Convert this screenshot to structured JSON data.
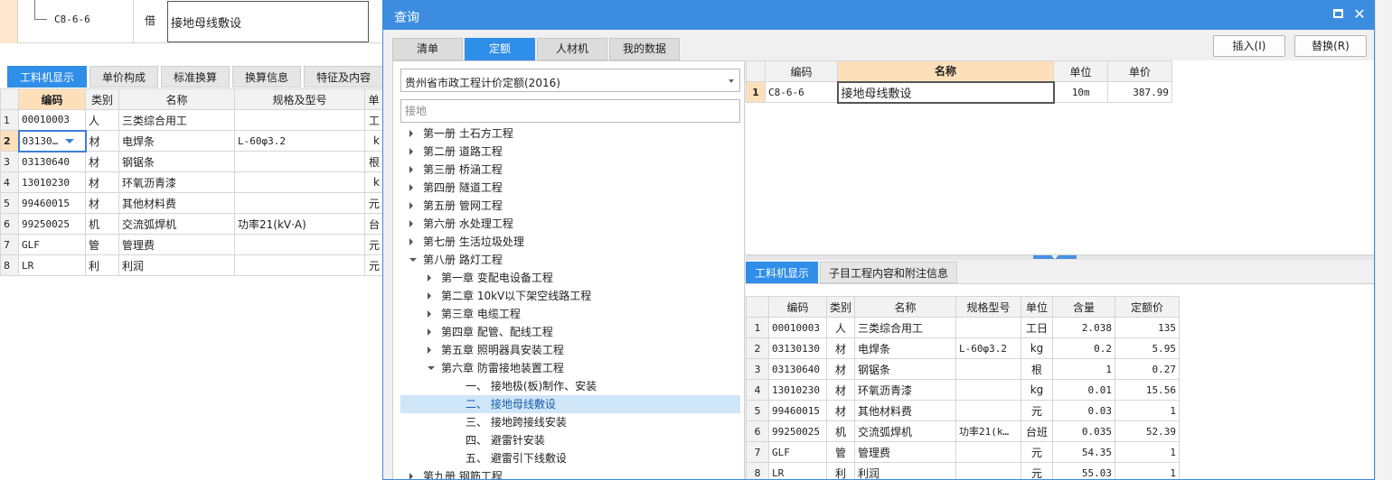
{
  "background": {
    "top_row": {
      "code": "C8-6-6",
      "type": "借",
      "name": "接地母线敷设"
    },
    "tabs": [
      "工料机显示",
      "单价构成",
      "标准换算",
      "换算信息",
      "特征及内容"
    ],
    "grid": {
      "headers": [
        "编码",
        "类别",
        "名称",
        "规格及型号",
        "单"
      ],
      "rows": [
        {
          "n": "1",
          "code": "00010003",
          "type": "人",
          "name": "三类综合用工",
          "spec": "",
          "unit": "工"
        },
        {
          "n": "2",
          "code": "03130…",
          "type": "材",
          "name": "电焊条",
          "spec": "L-60φ3.2",
          "unit": "k"
        },
        {
          "n": "3",
          "code": "03130640",
          "type": "材",
          "name": "钢锯条",
          "spec": "",
          "unit": "根"
        },
        {
          "n": "4",
          "code": "13010230",
          "type": "材",
          "name": "环氧沥青漆",
          "spec": "",
          "unit": "k"
        },
        {
          "n": "5",
          "code": "99460015",
          "type": "材",
          "name": "其他材料费",
          "spec": "",
          "unit": "元"
        },
        {
          "n": "6",
          "code": "99250025",
          "type": "机",
          "name": "交流弧焊机",
          "spec": "功率21(kV·A)",
          "unit": "台"
        },
        {
          "n": "7",
          "code": "GLF",
          "type": "管",
          "name": "管理费",
          "spec": "",
          "unit": "元"
        },
        {
          "n": "8",
          "code": "LR",
          "type": "利",
          "name": "利润",
          "spec": "",
          "unit": "元"
        }
      ]
    }
  },
  "dialog": {
    "title": "查询",
    "close_glyph": "✕",
    "tabs": [
      "清单",
      "定额",
      "人材机",
      "我的数据"
    ],
    "insert_label": "插入(I)",
    "replace_label": "替换(R)",
    "quota_book": "贵州省市政工程计价定额(2016)",
    "search": {
      "value": "",
      "placeholder": "接地"
    },
    "tree": [
      {
        "label": "第一册 土石方工程",
        "level": 0,
        "state": "collapsed"
      },
      {
        "label": "第二册 道路工程",
        "level": 0,
        "state": "collapsed"
      },
      {
        "label": "第三册 桥涵工程",
        "level": 0,
        "state": "collapsed"
      },
      {
        "label": "第四册 隧道工程",
        "level": 0,
        "state": "collapsed"
      },
      {
        "label": "第五册 管网工程",
        "level": 0,
        "state": "collapsed"
      },
      {
        "label": "第六册 水处理工程",
        "level": 0,
        "state": "collapsed"
      },
      {
        "label": "第七册 生活垃圾处理",
        "level": 0,
        "state": "collapsed"
      },
      {
        "label": "第八册 路灯工程",
        "level": 0,
        "state": "expanded"
      },
      {
        "label": "第一章 变配电设备工程",
        "level": 1,
        "state": "collapsed"
      },
      {
        "label": "第二章 10kV以下架空线路工程",
        "level": 1,
        "state": "collapsed"
      },
      {
        "label": "第三章 电缆工程",
        "level": 1,
        "state": "collapsed"
      },
      {
        "label": "第四章 配管、配线工程",
        "level": 1,
        "state": "collapsed"
      },
      {
        "label": "第五章 照明器具安装工程",
        "level": 1,
        "state": "collapsed"
      },
      {
        "label": "第六章 防雷接地装置工程",
        "level": 1,
        "state": "expanded"
      },
      {
        "label": "一、 接地极(板)制作、安装",
        "level": 2,
        "state": "leaf"
      },
      {
        "label": "二、 接地母线敷设",
        "level": 2,
        "state": "leaf",
        "selected": true
      },
      {
        "label": "三、 接地跨接线安装",
        "level": 2,
        "state": "leaf"
      },
      {
        "label": "四、 避雷针安装",
        "level": 2,
        "state": "leaf"
      },
      {
        "label": "五、 避雷引下线敷设",
        "level": 2,
        "state": "leaf"
      },
      {
        "label": "第九册 钢筋工程",
        "level": 0,
        "state": "collapsed"
      }
    ],
    "results": {
      "headers": [
        "编码",
        "名称",
        "单位",
        "单价"
      ],
      "rows": [
        {
          "n": "1",
          "code": "C8-6-6",
          "name": "接地母线敷设",
          "unit": "10m",
          "price": "387.99"
        }
      ]
    },
    "detail_tabs": [
      "工料机显示",
      "子目工程内容和附注信息"
    ],
    "detail": {
      "headers": [
        "编码",
        "类别",
        "名称",
        "规格型号",
        "单位",
        "含量",
        "定额价"
      ],
      "rows": [
        {
          "n": "1",
          "code": "00010003",
          "type": "人",
          "name": "三类综合用工",
          "spec": "",
          "unit": "工日",
          "qty": "2.038",
          "price": "135"
        },
        {
          "n": "2",
          "code": "03130130",
          "type": "材",
          "name": "电焊条",
          "spec": "L-60φ3.2",
          "unit": "kg",
          "qty": "0.2",
          "price": "5.95"
        },
        {
          "n": "3",
          "code": "03130640",
          "type": "材",
          "name": "钢锯条",
          "spec": "",
          "unit": "根",
          "qty": "1",
          "price": "0.27"
        },
        {
          "n": "4",
          "code": "13010230",
          "type": "材",
          "name": "环氧沥青漆",
          "spec": "",
          "unit": "kg",
          "qty": "0.01",
          "price": "15.56"
        },
        {
          "n": "5",
          "code": "99460015",
          "type": "材",
          "name": "其他材料费",
          "spec": "",
          "unit": "元",
          "qty": "0.03",
          "price": "1"
        },
        {
          "n": "6",
          "code": "99250025",
          "type": "机",
          "name": "交流弧焊机",
          "spec": "功率21(k…",
          "unit": "台班",
          "qty": "0.035",
          "price": "52.39"
        },
        {
          "n": "7",
          "code": "GLF",
          "type": "管",
          "name": "管理费",
          "spec": "",
          "unit": "元",
          "qty": "54.35",
          "price": "1"
        },
        {
          "n": "8",
          "code": "LR",
          "type": "利",
          "name": "利润",
          "spec": "",
          "unit": "元",
          "qty": "55.03",
          "price": "1"
        }
      ]
    }
  }
}
